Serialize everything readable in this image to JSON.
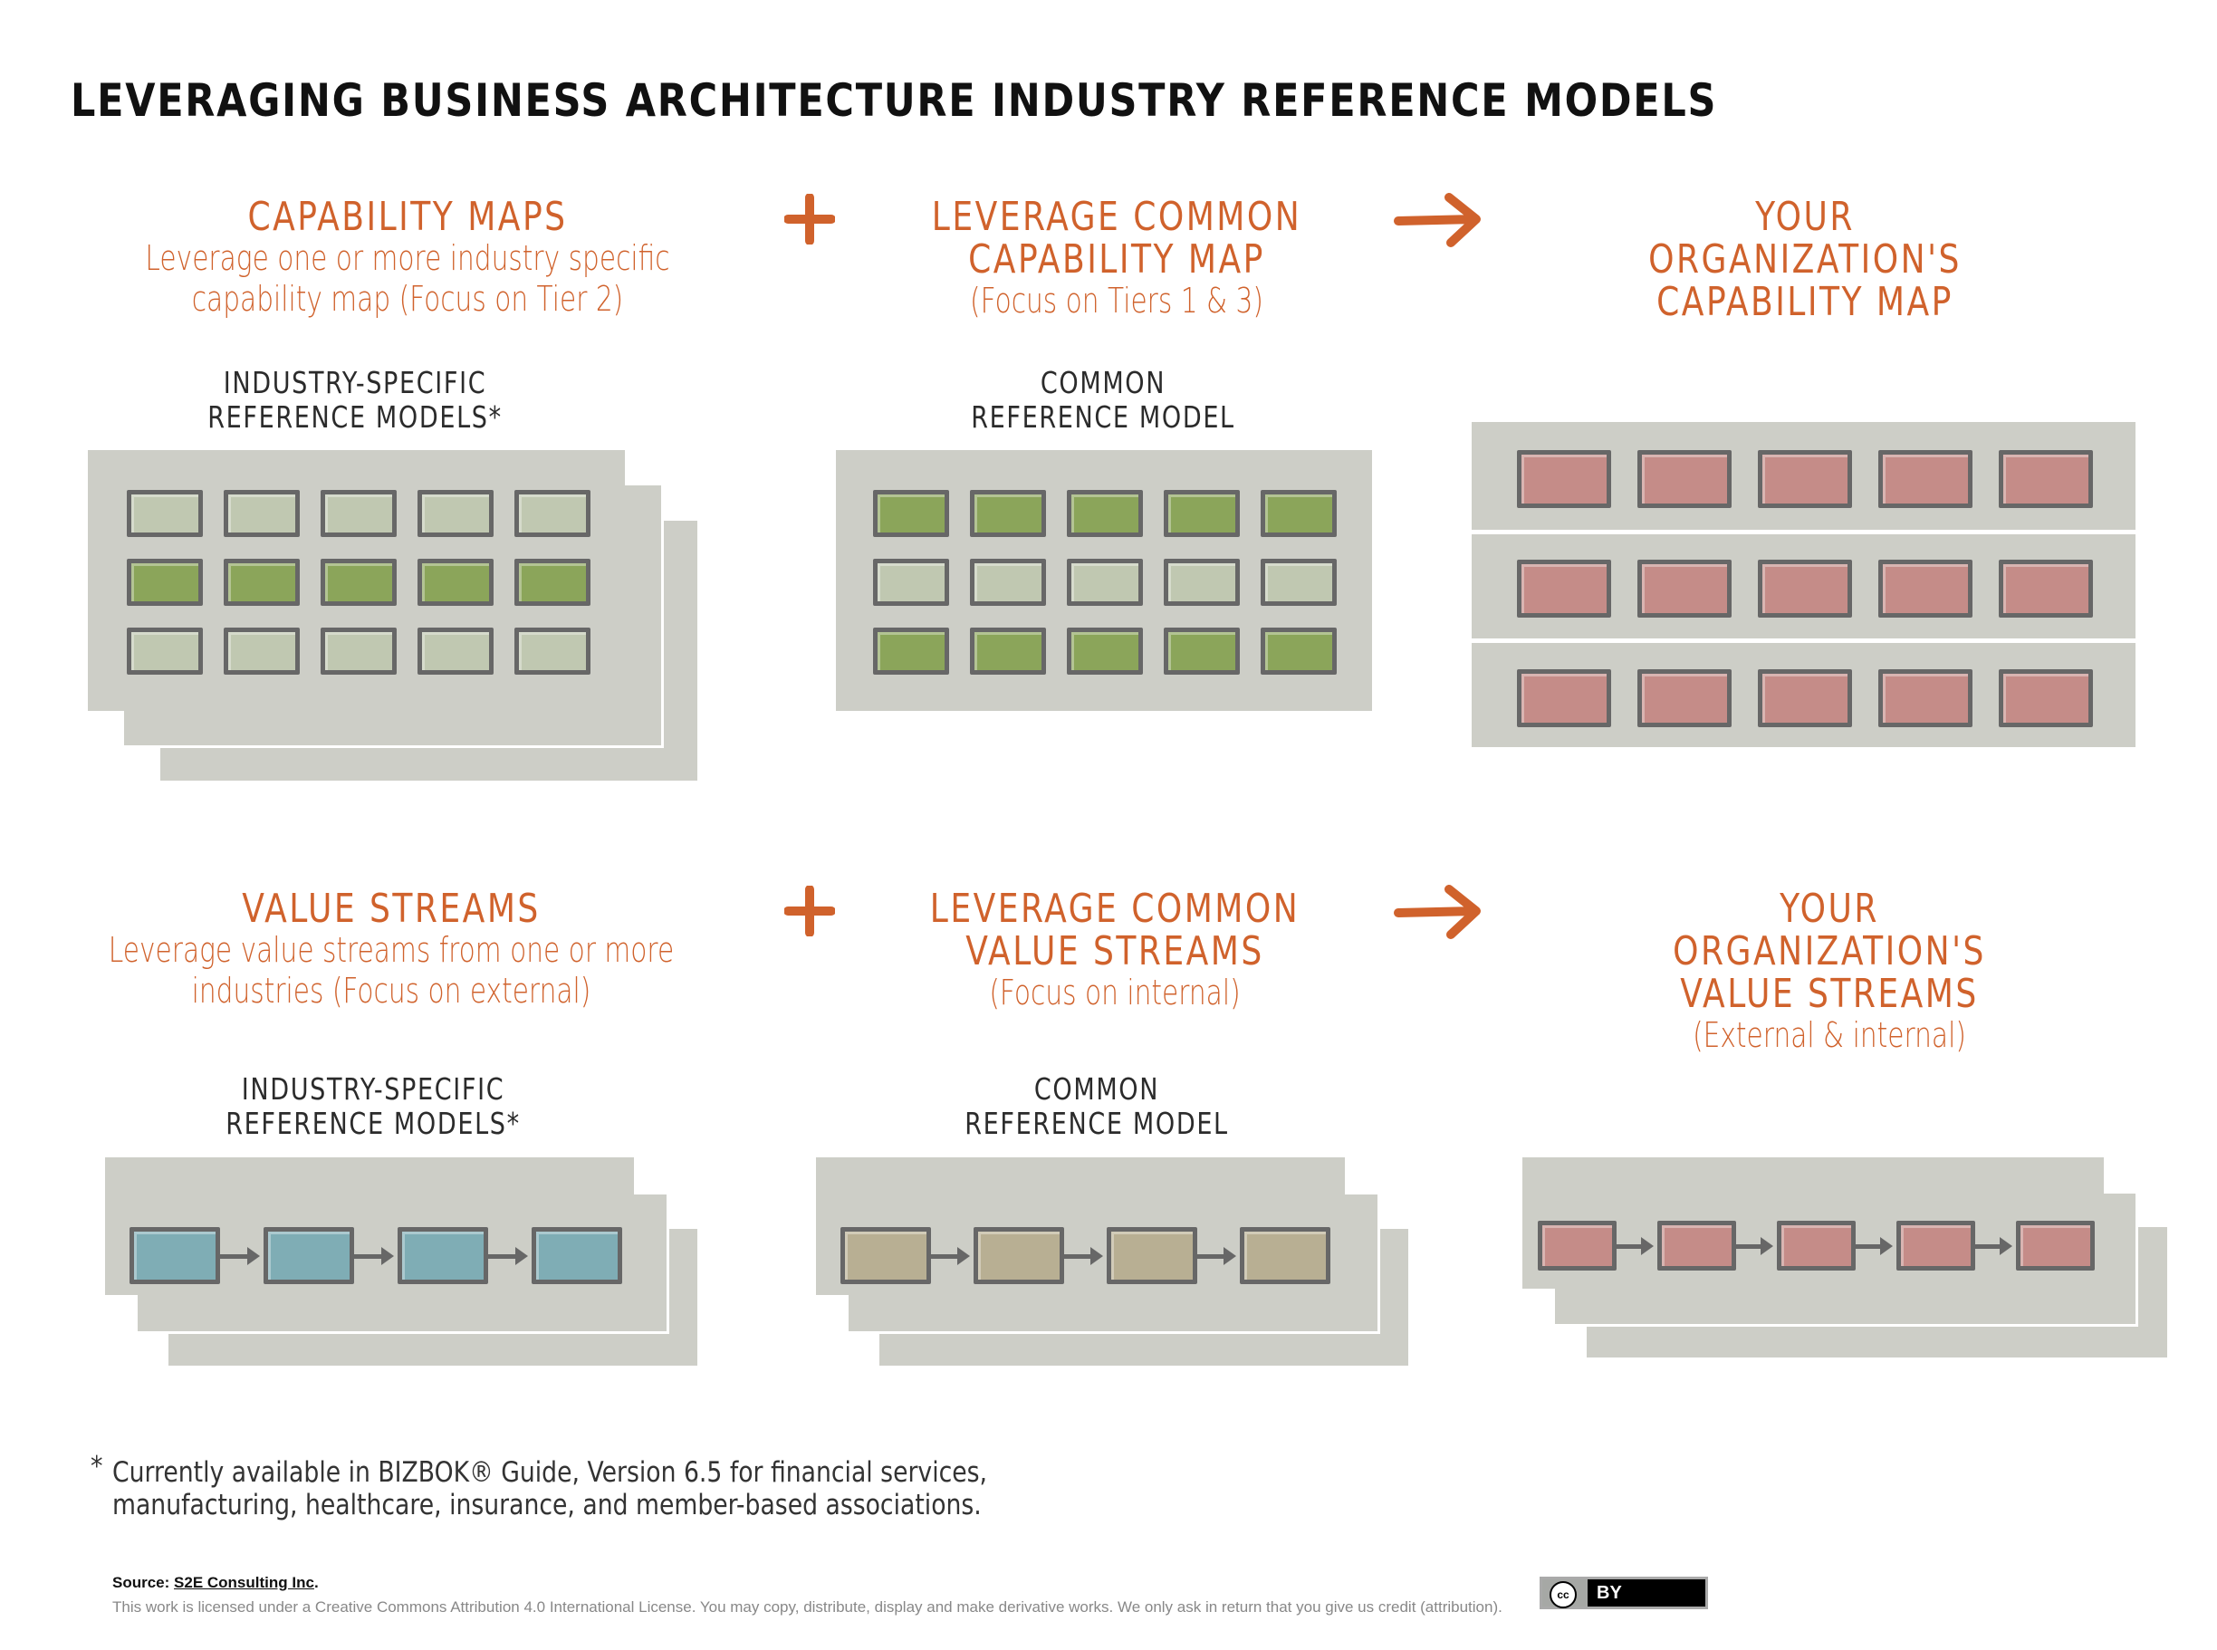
{
  "title": "LEVERAGING BUSINESS ARCHITECTURE INDUSTRY REFERENCE MODELS",
  "colors": {
    "accent": "#D0622C",
    "panel": "#CDCEC7",
    "box_light": "#C0C8B1",
    "box_green": "#8BA55A",
    "box_pink": "#C58C88",
    "box_teal": "#7FADB5",
    "box_tan": "#B8AF93",
    "stroke": "#676767"
  },
  "capability_row": {
    "left": {
      "heading": "CAPABILITY MAPS",
      "sub_lines": [
        "Leverage one or more industry specific",
        "capability map (Focus on Tier 2)"
      ],
      "label_lines": [
        "INDUSTRY-SPECIFIC",
        "REFERENCE MODELS*"
      ],
      "grid": [
        [
          "light",
          "light",
          "light",
          "light",
          "light"
        ],
        [
          "green",
          "green",
          "green",
          "green",
          "green"
        ],
        [
          "light",
          "light",
          "light",
          "light",
          "light"
        ]
      ]
    },
    "operator_plus": "+",
    "middle": {
      "heading_lines": [
        "LEVERAGE COMMON",
        "CAPABILITY MAP"
      ],
      "sub_lines": [
        "(Focus on Tiers 1 & 3)"
      ],
      "label_lines": [
        "COMMON",
        "REFERENCE MODEL"
      ],
      "grid": [
        [
          "green",
          "green",
          "green",
          "green",
          "green"
        ],
        [
          "light",
          "light",
          "light",
          "light",
          "light"
        ],
        [
          "green",
          "green",
          "green",
          "green",
          "green"
        ]
      ]
    },
    "operator_arrow": "→",
    "right": {
      "heading_lines": [
        "YOUR",
        "ORGANIZATION'S",
        "CAPABILITY MAP"
      ],
      "grid": [
        [
          "pink",
          "pink",
          "pink",
          "pink",
          "pink"
        ],
        [
          "pink",
          "pink",
          "pink",
          "pink",
          "pink"
        ],
        [
          "pink",
          "pink",
          "pink",
          "pink",
          "pink"
        ]
      ]
    }
  },
  "value_stream_row": {
    "left": {
      "heading": "VALUE STREAMS",
      "sub_lines": [
        "Leverage value streams from one or more",
        "industries (Focus on external)"
      ],
      "label_lines": [
        "INDUSTRY-SPECIFIC",
        "REFERENCE MODELS*"
      ],
      "stages": [
        "teal",
        "teal",
        "teal",
        "teal"
      ]
    },
    "operator_plus": "+",
    "middle": {
      "heading_lines": [
        "LEVERAGE COMMON",
        "VALUE STREAMS"
      ],
      "sub_lines": [
        "(Focus on internal)"
      ],
      "label_lines": [
        "COMMON",
        "REFERENCE MODEL"
      ],
      "stages": [
        "tan",
        "tan",
        "tan",
        "tan"
      ]
    },
    "operator_arrow": "→",
    "right": {
      "heading_lines": [
        "YOUR",
        "ORGANIZATION'S",
        "VALUE STREAMS"
      ],
      "sub_lines": [
        "(External & internal)"
      ],
      "stages": [
        "pink",
        "pink",
        "pink",
        "pink",
        "pink"
      ]
    }
  },
  "footnote": {
    "marker": "*",
    "lines": [
      "Currently available in BIZBOK® Guide, Version 6.5 for financial services,",
      "manufacturing, healthcare, insurance, and member-based associations."
    ]
  },
  "source": {
    "prefix": "Source: ",
    "link_text": "S2E Consulting Inc",
    "suffix": "."
  },
  "license_text": "This work is licensed under a Creative Commons Attribution 4.0 International License. You may copy, distribute, display and make derivative works. We only ask in return that you give us credit (attribution).",
  "cc_badge": {
    "cc": "cc",
    "by": "BY"
  }
}
